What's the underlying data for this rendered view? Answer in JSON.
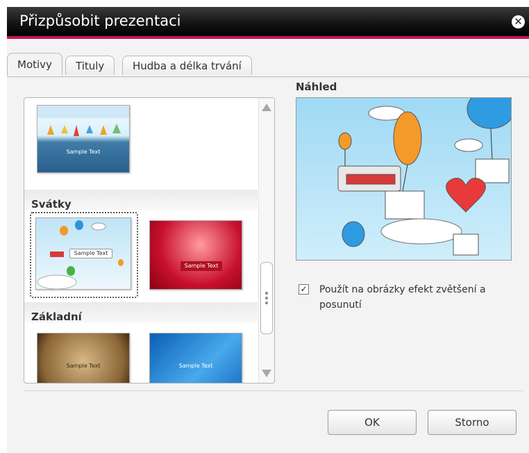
{
  "window": {
    "title": "Přizpůsobit prezentaci"
  },
  "tabs": [
    {
      "label": "Motivy",
      "active": true
    },
    {
      "label": "Tituly",
      "active": false
    },
    {
      "label": "Hudba a délka trvání",
      "active": false
    }
  ],
  "themes": {
    "sections": [
      {
        "label": "Svátky"
      },
      {
        "label": "Základní"
      }
    ],
    "thumbnails": [
      {
        "caption": "Sample Text"
      },
      {
        "caption": "Sample Text"
      },
      {
        "caption": "Sample Text"
      },
      {
        "caption": "Sample Text"
      },
      {
        "caption": "Sample Text"
      }
    ]
  },
  "preview": {
    "label": "Náhled"
  },
  "option": {
    "label": "Použít na obrázky efekt zvětšení a posunutí",
    "checked": true
  },
  "buttons": {
    "ok": "OK",
    "cancel": "Storno"
  },
  "colors": {
    "accent": "#c4145a",
    "titlebar": "#111111"
  }
}
